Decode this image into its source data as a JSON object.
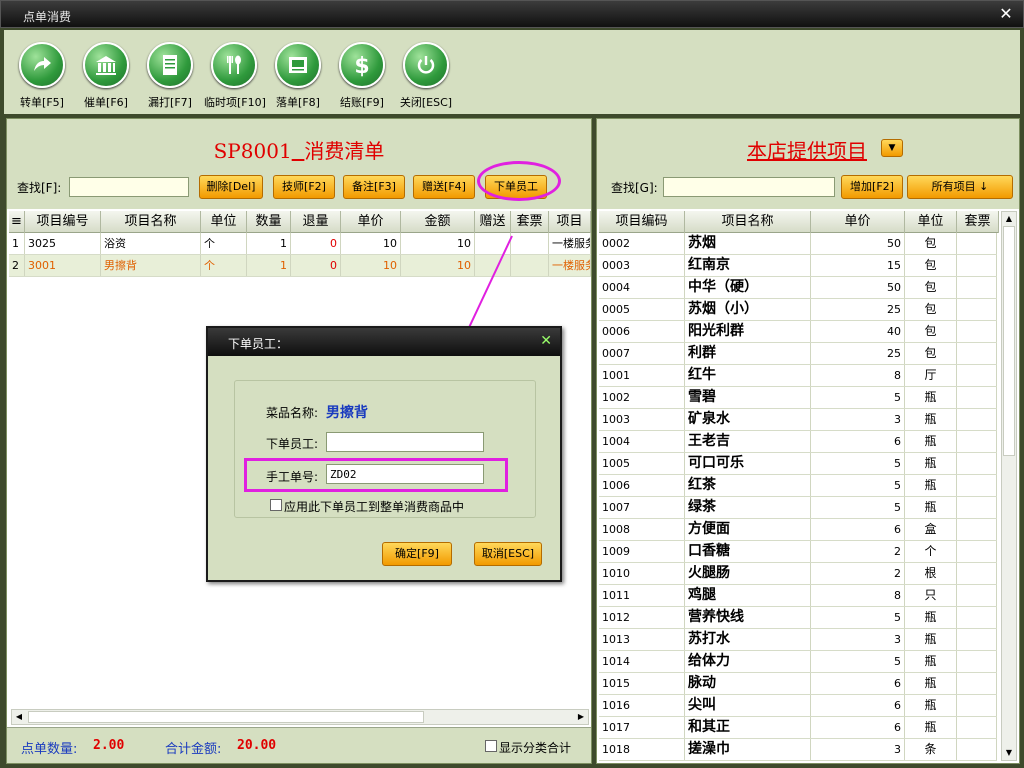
{
  "window": {
    "title": "点单消费"
  },
  "toolbar": [
    {
      "label": "转单[F5]",
      "icon": "arrow-right-icon"
    },
    {
      "label": "催单[F6]",
      "icon": "bank-icon"
    },
    {
      "label": "漏打[F7]",
      "icon": "document-icon"
    },
    {
      "label": "临时项[F10]",
      "icon": "fork-spoon-icon"
    },
    {
      "label": "落单[F8]",
      "icon": "receipt-icon"
    },
    {
      "label": "结账[F9]",
      "icon": "dollar-icon"
    },
    {
      "label": "关闭[ESC]",
      "icon": "power-icon"
    }
  ],
  "left": {
    "room": "SP8001",
    "title": "消费清单",
    "search_label": "查找[F]:",
    "search_value": "",
    "buttons": {
      "delete": "删除[Del]",
      "tech": "技师[F2]",
      "note": "备注[F3]",
      "gift": "赠送[F4]",
      "staff": "下单员工"
    },
    "columns": [
      "项目编号",
      "项目名称",
      "单位",
      "数量",
      "退量",
      "单价",
      "金额",
      "赠送",
      "套票",
      "项目"
    ],
    "rows": [
      {
        "idx": "1",
        "code": "3025",
        "name": "浴资",
        "unit": "个",
        "qty": "1",
        "ret": "0",
        "price": "10",
        "amount": "10",
        "gift": "",
        "pkg": "",
        "cat": "一楼服务"
      },
      {
        "idx": "2",
        "code": "3001",
        "name": "男擦背",
        "unit": "个",
        "qty": "1",
        "ret": "0",
        "price": "10",
        "amount": "10",
        "gift": "",
        "pkg": "",
        "cat": "一楼服务"
      }
    ],
    "footer": {
      "count_label": "点单数量:",
      "count_value": "2.00",
      "total_label": "合计金额:",
      "total_value": "20.00",
      "show_cat_label": "显示分类合计"
    }
  },
  "right": {
    "title": "本店提供项目",
    "search_label": "查找[G]:",
    "search_value": "",
    "add_button": "增加[F2]",
    "all_button": "所有项目 ↓",
    "columns": [
      "项目编码",
      "项目名称",
      "单价",
      "单位",
      "套票"
    ],
    "items": [
      {
        "code": "0002",
        "name": "苏烟",
        "price": "50",
        "unit": "包"
      },
      {
        "code": "0003",
        "name": "红南京",
        "price": "15",
        "unit": "包"
      },
      {
        "code": "0004",
        "name": "中华（硬）",
        "price": "50",
        "unit": "包"
      },
      {
        "code": "0005",
        "name": "苏烟（小）",
        "price": "25",
        "unit": "包"
      },
      {
        "code": "0006",
        "name": "阳光利群",
        "price": "40",
        "unit": "包"
      },
      {
        "code": "0007",
        "name": "利群",
        "price": "25",
        "unit": "包"
      },
      {
        "code": "1001",
        "name": "红牛",
        "price": "8",
        "unit": "厅"
      },
      {
        "code": "1002",
        "name": "雪碧",
        "price": "5",
        "unit": "瓶"
      },
      {
        "code": "1003",
        "name": "矿泉水",
        "price": "3",
        "unit": "瓶"
      },
      {
        "code": "1004",
        "name": "王老吉",
        "price": "6",
        "unit": "瓶"
      },
      {
        "code": "1005",
        "name": "可口可乐",
        "price": "5",
        "unit": "瓶"
      },
      {
        "code": "1006",
        "name": "红茶",
        "price": "5",
        "unit": "瓶"
      },
      {
        "code": "1007",
        "name": "绿茶",
        "price": "5",
        "unit": "瓶"
      },
      {
        "code": "1008",
        "name": "方便面",
        "price": "6",
        "unit": "盒"
      },
      {
        "code": "1009",
        "name": "口香糖",
        "price": "2",
        "unit": "个"
      },
      {
        "code": "1010",
        "name": "火腿肠",
        "price": "2",
        "unit": "根"
      },
      {
        "code": "1011",
        "name": "鸡腿",
        "price": "8",
        "unit": "只"
      },
      {
        "code": "1012",
        "name": "营养快线",
        "price": "5",
        "unit": "瓶"
      },
      {
        "code": "1013",
        "name": "苏打水",
        "price": "3",
        "unit": "瓶"
      },
      {
        "code": "1014",
        "name": "给体力",
        "price": "5",
        "unit": "瓶"
      },
      {
        "code": "1015",
        "name": "脉动",
        "price": "6",
        "unit": "瓶"
      },
      {
        "code": "1016",
        "name": "尖叫",
        "price": "6",
        "unit": "瓶"
      },
      {
        "code": "1017",
        "name": "和其正",
        "price": "6",
        "unit": "瓶"
      },
      {
        "code": "1018",
        "name": "搓澡巾",
        "price": "3",
        "unit": "条"
      }
    ]
  },
  "dialog": {
    "title": "下单员工：",
    "dish_label": "菜品名称:",
    "dish_value": "男擦背",
    "staff_label": "下单员工:",
    "staff_value": "",
    "manual_label": "手工单号:",
    "manual_value": "ZD02",
    "apply_label": "应用此下单员工到整单消费商品中",
    "ok_button": "确定[F9]",
    "cancel_button": "取消[ESC]"
  },
  "colors": {
    "accent": "#e00000",
    "panel": "#d5dfc1",
    "highlight": "#e020e0",
    "button": "#f6b11a"
  }
}
